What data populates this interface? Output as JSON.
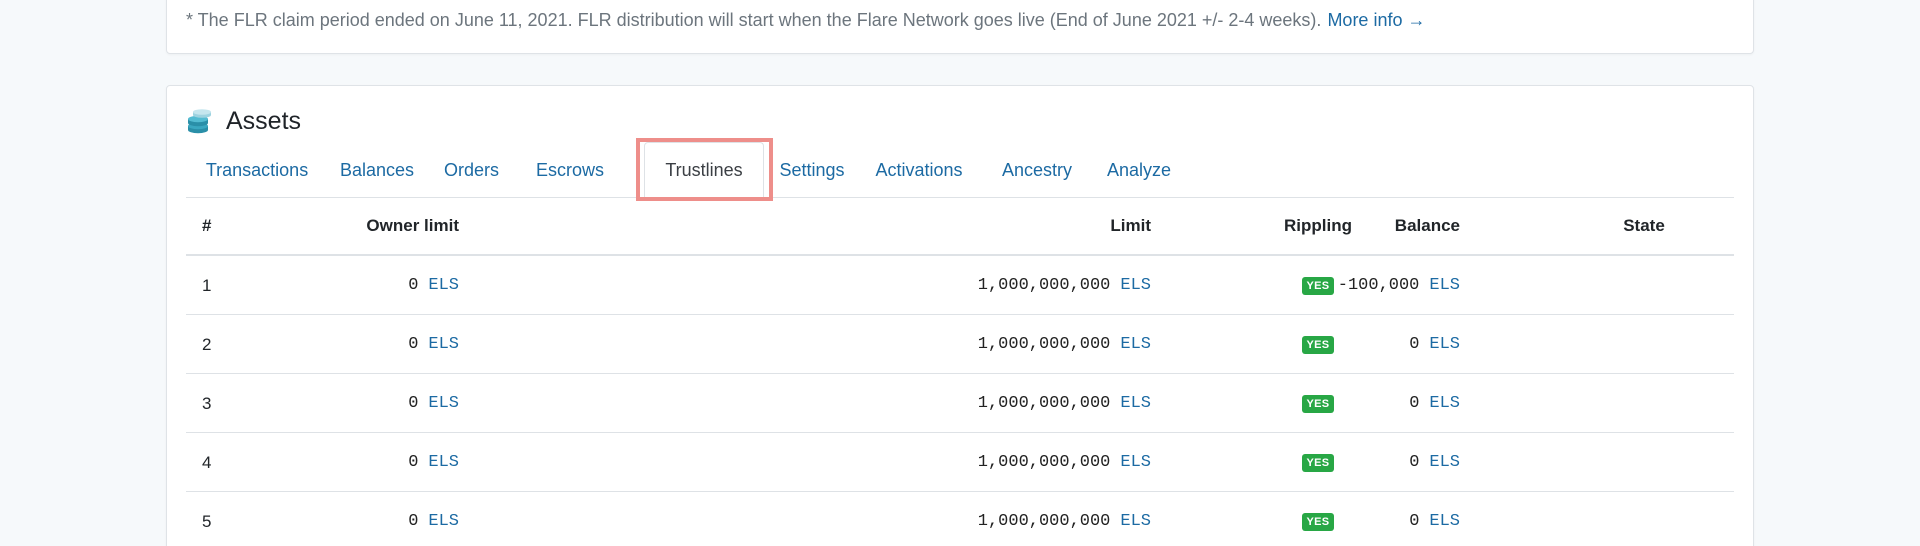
{
  "notice": {
    "text": "* The FLR claim period ended on June 11, 2021. FLR distribution will start when the Flare Network goes live (End of June 2021 +/- 2-4 weeks).",
    "link": "More info →"
  },
  "assets": {
    "icon": "coins-stack-icon",
    "title": "Assets"
  },
  "tabs": [
    {
      "label": "Transactions"
    },
    {
      "label": "Balances"
    },
    {
      "label": "Orders"
    },
    {
      "label": "Escrows"
    },
    {
      "label": "Trustlines",
      "active": true
    },
    {
      "label": "Settings"
    },
    {
      "label": "Activations"
    },
    {
      "label": "Ancestry"
    },
    {
      "label": "Analyze"
    }
  ],
  "table": {
    "headers": {
      "num": "#",
      "owner_limit": "Owner limit",
      "limit": "Limit",
      "balance": "Balance",
      "rippling": "Rippling",
      "state": "State"
    },
    "rows": [
      {
        "num": "1",
        "owner_limit": "0",
        "owner_cur": "ELS",
        "limit": "1,000,000,000",
        "limit_cur": "ELS",
        "balance": "-100,000",
        "balance_cur": "ELS",
        "rippling": "YES",
        "state": ""
      },
      {
        "num": "2",
        "owner_limit": "0",
        "owner_cur": "ELS",
        "limit": "1,000,000,000",
        "limit_cur": "ELS",
        "balance": "0",
        "balance_cur": "ELS",
        "rippling": "YES",
        "state": ""
      },
      {
        "num": "3",
        "owner_limit": "0",
        "owner_cur": "ELS",
        "limit": "1,000,000,000",
        "limit_cur": "ELS",
        "balance": "0",
        "balance_cur": "ELS",
        "rippling": "YES",
        "state": ""
      },
      {
        "num": "4",
        "owner_limit": "0",
        "owner_cur": "ELS",
        "limit": "1,000,000,000",
        "limit_cur": "ELS",
        "balance": "0",
        "balance_cur": "ELS",
        "rippling": "YES",
        "state": ""
      },
      {
        "num": "5",
        "owner_limit": "0",
        "owner_cur": "ELS",
        "limit": "1,000,000,000",
        "limit_cur": "ELS",
        "balance": "0",
        "balance_cur": "ELS",
        "rippling": "YES",
        "state": ""
      }
    ]
  },
  "colors": {
    "link": "#1c6aa3",
    "badge_green": "#28a745",
    "highlight": "#ee8e8a",
    "background": "#f6f9fb"
  }
}
